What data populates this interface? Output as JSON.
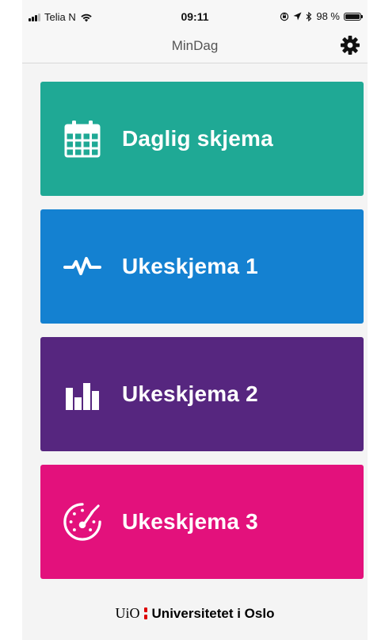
{
  "status_bar": {
    "carrier": "Telia N",
    "time": "09:11",
    "battery_text": "98 %",
    "battery_level": 0.98
  },
  "nav": {
    "title": "MinDag"
  },
  "tiles": [
    {
      "label": "Daglig skjema",
      "color": "#1fa995",
      "icon": "calendar-icon"
    },
    {
      "label": "Ukeskjema 1",
      "color": "#1481d1",
      "icon": "pulse-icon"
    },
    {
      "label": "Ukeskjema 2",
      "color": "#56267f",
      "icon": "bar-chart-icon"
    },
    {
      "label": "Ukeskjema 3",
      "color": "#e3117c",
      "icon": "speedometer-icon"
    }
  ],
  "footer": {
    "uio": "UiO",
    "university": "Universitetet i Oslo"
  }
}
